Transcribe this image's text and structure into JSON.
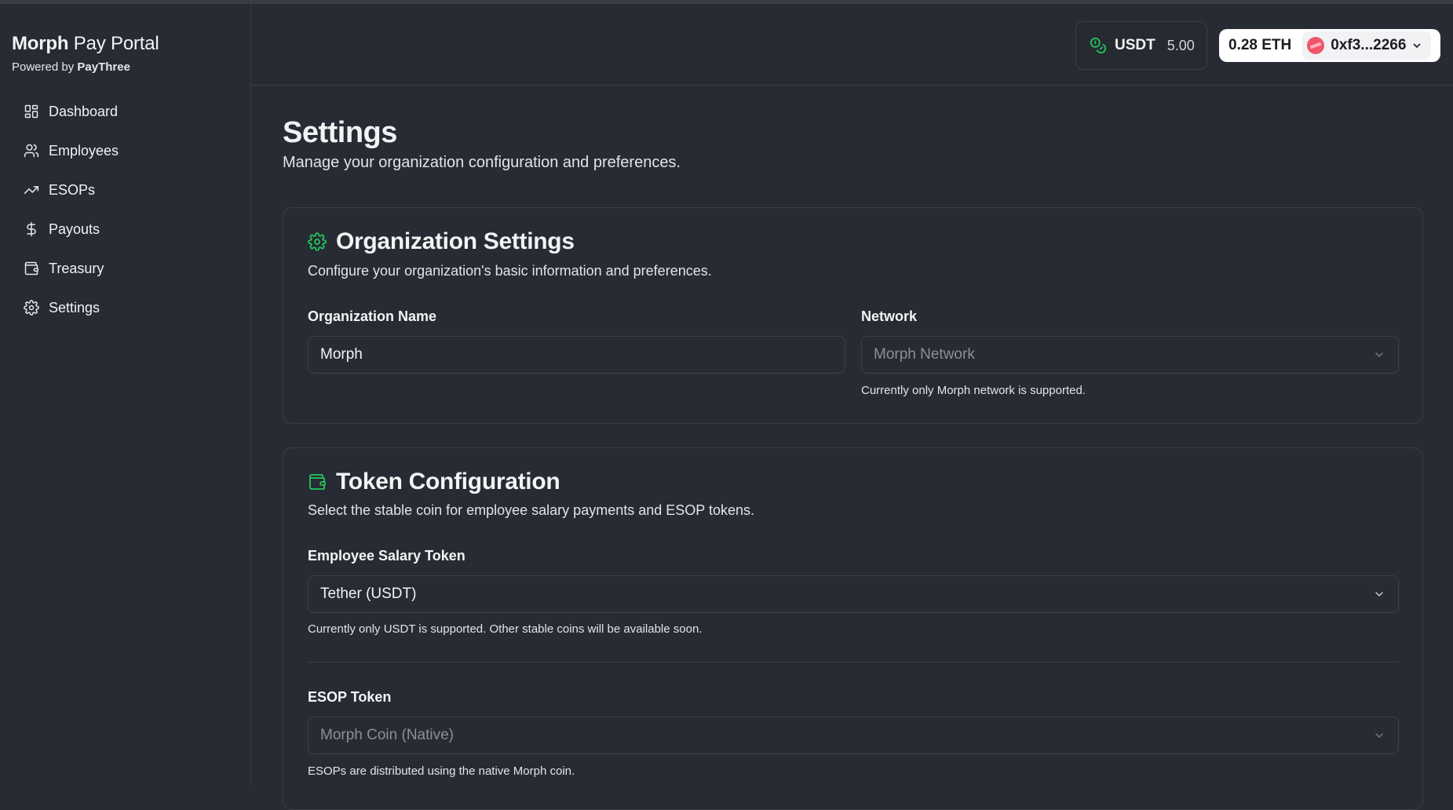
{
  "brand": {
    "title_bold": "Morph",
    "title_light": "Pay Portal",
    "sub_prefix": "Powered by",
    "sub_bold": "PayThree"
  },
  "nav": [
    {
      "label": "Dashboard",
      "icon": "dashboard-icon"
    },
    {
      "label": "Employees",
      "icon": "users-icon"
    },
    {
      "label": "ESOPs",
      "icon": "trending-up-icon"
    },
    {
      "label": "Payouts",
      "icon": "dollar-icon"
    },
    {
      "label": "Treasury",
      "icon": "wallet-icon"
    },
    {
      "label": "Settings",
      "icon": "gear-icon"
    }
  ],
  "header": {
    "token_symbol": "USDT",
    "token_balance": "5.00",
    "eth_balance": "0.28 ETH",
    "address": "0xf3...2266"
  },
  "page": {
    "title": "Settings",
    "description": "Manage your organization configuration and preferences."
  },
  "org_settings": {
    "title": "Organization Settings",
    "description": "Configure your organization's basic information and preferences.",
    "name_label": "Organization Name",
    "name_value": "Morph",
    "network_label": "Network",
    "network_value": "Morph Network",
    "network_help": "Currently only Morph network is supported."
  },
  "token_config": {
    "title": "Token Configuration",
    "description": "Select the stable coin for employee salary payments and ESOP tokens.",
    "salary_label": "Employee Salary Token",
    "salary_value": "Tether (USDT)",
    "salary_help": "Currently only USDT is supported. Other stable coins will be available soon.",
    "esop_label": "ESOP Token",
    "esop_value": "Morph Coin (Native)",
    "esop_help": "ESOPs are distributed using the native Morph coin."
  },
  "colors": {
    "accent": "#22c55e",
    "background": "#272b33",
    "border": "#3a3f48"
  }
}
